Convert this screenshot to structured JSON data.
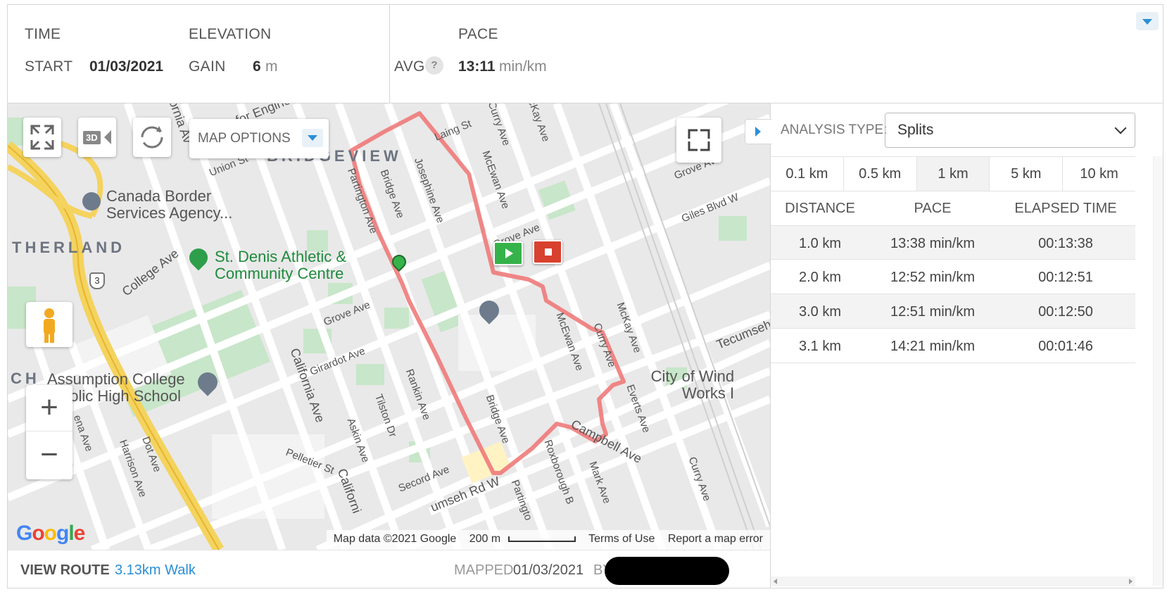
{
  "stats": {
    "time_label": "TIME",
    "start_label": "START",
    "start_value": "01/03/2021",
    "elevation_label": "ELEVATION",
    "gain_label": "GAIN",
    "gain_value": "6",
    "gain_unit": "m",
    "pace_label": "PACE",
    "avg_label": "AVG",
    "help_glyph": "?",
    "avg_value": "13:11",
    "avg_unit": "min/km"
  },
  "map": {
    "options_label": "MAP OPTIONS",
    "threed_label": "3D",
    "zoom_in": "+",
    "zoom_out": "−",
    "area_labels": {
      "bridgeview": "BRIDGEVIEW",
      "sutherland": "THERLAND",
      "ch": "CH"
    },
    "pois": {
      "cbsa": [
        "Canada Border",
        "Services Agency..."
      ],
      "st_denis": [
        "St. Denis Athletic &",
        "Community Centre"
      ],
      "assumption": [
        "Assumption College",
        "holic High School"
      ],
      "city_works": [
        "City of Wind",
        "Works I"
      ]
    },
    "streets": {
      "laing": "Laing St",
      "mcewan_top": "McEwan Ave",
      "curry_top": "Curry Ave",
      "mckay_top": "McKay Ave",
      "partington": "Partington Ave",
      "bridge_top": "Bridge Ave",
      "josephine": "Josephine Ave",
      "grove_mid": "Grove Ave",
      "grove_left": "Grove Ave",
      "grove_right": "Grove Ave",
      "giles": "Giles Blvd W",
      "college": "College Ave",
      "union": "Union St",
      "girardot": "Girardot Ave",
      "california": "California Ave",
      "california_bottom": "Californi",
      "rankin": "Rankin Ave",
      "tilston": "Tilston Dr",
      "askin": "Askin Ave",
      "bridge_bottom": "Bridge Ave",
      "mcewan_mid": "McEwan Ave",
      "curry_mid": "Curry Ave",
      "mckay_mid": "McKay Ave",
      "everts": "Everts Ave",
      "campbell": "Campbell Ave",
      "roxborough": "Roxborough B",
      "mark": "Mark Ave",
      "curry_bottom": "Curry Ave",
      "tecumseh_right": "Tecumseh",
      "tecumseh_bottom": "umseh Rd W",
      "secord": "Secord Ave",
      "pelletier": "Pelletier St",
      "harrison": "Harrison Ave",
      "dot": "Dot Ave",
      "lena": "ena Ave",
      "partington_bottom": "Partingto",
      "california_top": "ornia Av",
      "engineering": "for Engineering..",
      "highway": "3"
    },
    "google_logo": "Google",
    "attribution": {
      "map_data": "Map data ©2021 Google",
      "scale": "200 m",
      "terms": "Terms of Use",
      "report": "Report a map error"
    },
    "colors": {
      "route": "#f07a7a",
      "start_marker": "#36b24a",
      "end_marker": "#d9412f",
      "park": "#c8e6c9"
    }
  },
  "footer": {
    "view_route_label": "VIEW ROUTE",
    "route_link": "3.13km Walk",
    "mapped_label": "MAPPED",
    "mapped_date": "01/03/2021",
    "by_label": "BY"
  },
  "analysis": {
    "type_label": "ANALYSIS TYPE:",
    "type_value": "Splits",
    "segments": [
      "0.1 km",
      "0.5 km",
      "1 km",
      "5 km",
      "10 km"
    ],
    "active_segment": "1 km",
    "columns": [
      "DISTANCE",
      "PACE",
      "ELAPSED TIME"
    ],
    "rows": [
      {
        "distance": "1.0 km",
        "pace": "13:38 min/km",
        "elapsed": "00:13:38"
      },
      {
        "distance": "2.0 km",
        "pace": "12:52 min/km",
        "elapsed": "00:12:51"
      },
      {
        "distance": "3.0 km",
        "pace": "12:51 min/km",
        "elapsed": "00:12:50"
      },
      {
        "distance": "3.1 km",
        "pace": "14:21 min/km",
        "elapsed": "00:01:46"
      }
    ]
  }
}
